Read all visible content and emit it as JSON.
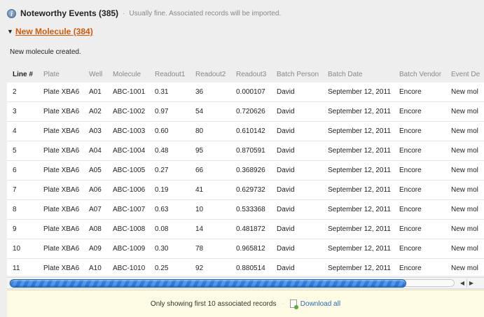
{
  "header": {
    "icon": "info-icon",
    "title": "Noteworthy Events (385)",
    "separator": "·",
    "subtitle": "Usually fine. Associated records will be imported."
  },
  "section": {
    "toggle_icon": "triangle-down-icon",
    "title": "New Molecule (384)",
    "link_color": "#d15c0b",
    "message": "New molecule created."
  },
  "table": {
    "columns": [
      "Line #",
      "Plate",
      "Well",
      "Molecule",
      "Readout1",
      "Readout2",
      "Readout3",
      "Batch Person",
      "Batch Date",
      "Batch Vendor",
      "Event De"
    ],
    "rows": [
      [
        "2",
        "Plate XBA6",
        "A01",
        "ABC-1001",
        "0.31",
        "36",
        "0.000107",
        "David",
        "September 12, 2011",
        "Encore",
        "New mol"
      ],
      [
        "3",
        "Plate XBA6",
        "A02",
        "ABC-1002",
        "0.97",
        "54",
        "0.720626",
        "David",
        "September 12, 2011",
        "Encore",
        "New mol"
      ],
      [
        "4",
        "Plate XBA6",
        "A03",
        "ABC-1003",
        "0.60",
        "80",
        "0.610142",
        "David",
        "September 12, 2011",
        "Encore",
        "New mol"
      ],
      [
        "5",
        "Plate XBA6",
        "A04",
        "ABC-1004",
        "0.48",
        "95",
        "0.870591",
        "David",
        "September 12, 2011",
        "Encore",
        "New mol"
      ],
      [
        "6",
        "Plate XBA6",
        "A05",
        "ABC-1005",
        "0.27",
        "66",
        "0.368926",
        "David",
        "September 12, 2011",
        "Encore",
        "New mol"
      ],
      [
        "7",
        "Plate XBA6",
        "A06",
        "ABC-1006",
        "0.19",
        "41",
        "0.629732",
        "David",
        "September 12, 2011",
        "Encore",
        "New mol"
      ],
      [
        "8",
        "Plate XBA6",
        "A07",
        "ABC-1007",
        "0.63",
        "10",
        "0.533368",
        "David",
        "September 12, 2011",
        "Encore",
        "New mol"
      ],
      [
        "9",
        "Plate XBA6",
        "A08",
        "ABC-1008",
        "0.08",
        "14",
        "0.481872",
        "David",
        "September 12, 2011",
        "Encore",
        "New mol"
      ],
      [
        "10",
        "Plate XBA6",
        "A09",
        "ABC-1009",
        "0.30",
        "78",
        "0.965812",
        "David",
        "September 12, 2011",
        "Encore",
        "New mol"
      ],
      [
        "11",
        "Plate XBA6",
        "A10",
        "ABC-1010",
        "0.25",
        "92",
        "0.880514",
        "David",
        "September 12, 2011",
        "Encore",
        "New mol"
      ]
    ]
  },
  "scrollbar": {
    "left_icon": "arrow-left-icon",
    "right_icon": "arrow-right-icon"
  },
  "footer": {
    "notice": "Only showing first 10 associated records",
    "separator": "·",
    "download_icon": "download-file-icon",
    "download_label": "Download all"
  }
}
